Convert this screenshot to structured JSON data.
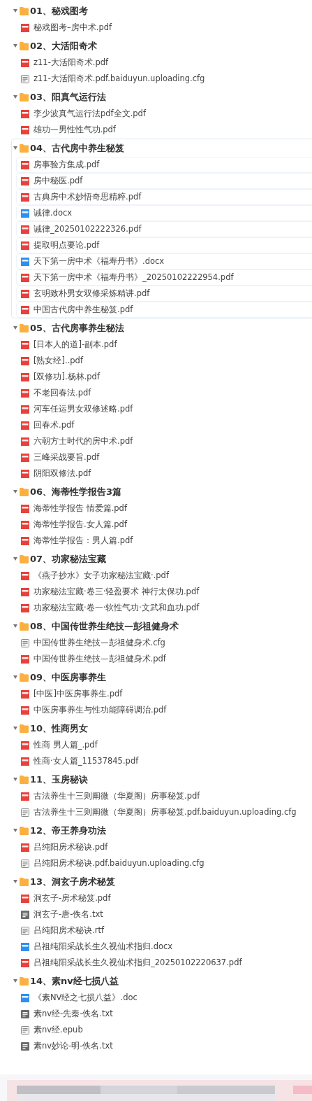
{
  "folders": [
    {
      "name": "01、秘戏图考",
      "expanded": true,
      "selected": false,
      "files": [
        {
          "kind": "pdf",
          "name": "秘戏图考–房中术.pdf"
        }
      ]
    },
    {
      "name": "02、大活阳奇术",
      "expanded": true,
      "selected": false,
      "files": [
        {
          "kind": "pdf",
          "name": "z11-大活阳奇术.pdf"
        },
        {
          "kind": "file",
          "name": "z11-大活阳奇术.pdf.baiduyun.uploading.cfg"
        }
      ]
    },
    {
      "name": "03、阳真气运行法",
      "expanded": true,
      "selected": false,
      "files": [
        {
          "kind": "pdf",
          "name": "李少波真气运行法pdf全文.pdf"
        },
        {
          "kind": "pdf",
          "name": "雄功—男性性气功.pdf"
        }
      ]
    },
    {
      "name": "04、古代房中养生秘笈",
      "expanded": true,
      "selected": true,
      "files": [
        {
          "kind": "pdf",
          "name": "房事验方集成.pdf"
        },
        {
          "kind": "pdf",
          "name": "房中秘医.pdf"
        },
        {
          "kind": "pdf",
          "name": "古典房中术妙悟奇思精粹.pdf"
        },
        {
          "kind": "doc",
          "name": "诫律.docx"
        },
        {
          "kind": "pdf",
          "name": "诫律_20250102222326.pdf"
        },
        {
          "kind": "pdf",
          "name": "提取明点要论.pdf"
        },
        {
          "kind": "doc",
          "name": "天下第一房中术《福寿丹书》.docx"
        },
        {
          "kind": "pdf",
          "name": "天下第一房中术《福寿丹书》_20250102222954.pdf"
        },
        {
          "kind": "pdf",
          "name": "玄明致朴男女双修采炼精讲.pdf"
        },
        {
          "kind": "pdf",
          "name": "中国古代房中养生秘笈.pdf"
        }
      ]
    },
    {
      "name": "05、古代房事养生秘法",
      "expanded": true,
      "selected": false,
      "files": [
        {
          "kind": "pdf",
          "name": "[日本人的道]-副本.pdf"
        },
        {
          "kind": "pdf",
          "name": "[熟女经]..pdf"
        },
        {
          "kind": "pdf",
          "name": "[双修功].杨林.pdf"
        },
        {
          "kind": "pdf",
          "name": "不老回春法.pdf"
        },
        {
          "kind": "pdf",
          "name": "河车任运男女双修述略.pdf"
        },
        {
          "kind": "pdf",
          "name": "回春术.pdf"
        },
        {
          "kind": "pdf",
          "name": "六朝方士时代的房中术.pdf"
        },
        {
          "kind": "pdf",
          "name": "三峰采战要旨.pdf"
        },
        {
          "kind": "pdf",
          "name": "阴阳双修法.pdf"
        }
      ]
    },
    {
      "name": "06、海蒂性学报告3篇",
      "expanded": true,
      "selected": false,
      "files": [
        {
          "kind": "pdf",
          "name": "海蒂性学报告 情爱篇.pdf"
        },
        {
          "kind": "pdf",
          "name": "海蒂性学报告.女人篇.pdf"
        },
        {
          "kind": "pdf",
          "name": "海蒂性学报告：男人篇.pdf"
        }
      ]
    },
    {
      "name": "07、功家秘法宝藏",
      "expanded": true,
      "selected": false,
      "files": [
        {
          "kind": "pdf",
          "name": "《燕子抄水》女子功家秘法宝藏·.pdf"
        },
        {
          "kind": "pdf",
          "name": "功家秘法宝藏·卷三·轻盈要术 神行太保功.pdf"
        },
        {
          "kind": "pdf",
          "name": "功家秘法宝藏·卷一·软性气功·文武和血功.pdf"
        }
      ]
    },
    {
      "name": "08、中国传世养生绝技—彭祖健身术",
      "expanded": true,
      "selected": false,
      "files": [
        {
          "kind": "file",
          "name": "中国传世养生绝技—彭祖健身术.cfg"
        },
        {
          "kind": "pdf",
          "name": "中国传世养生绝技—彭祖健身术.pdf"
        }
      ]
    },
    {
      "name": "09、中医房事养生",
      "expanded": true,
      "selected": false,
      "files": [
        {
          "kind": "pdf",
          "name": "[中医]中医房事养生.pdf"
        },
        {
          "kind": "pdf",
          "name": "中医房事养生与性功能障碍调治.pdf"
        }
      ]
    },
    {
      "name": "10、性商男女",
      "expanded": true,
      "selected": false,
      "files": [
        {
          "kind": "pdf",
          "name": "性商 男人篇_.pdf"
        },
        {
          "kind": "pdf",
          "name": "性商·女人篇_11537845.pdf"
        }
      ]
    },
    {
      "name": "11、玉房秘诀",
      "expanded": true,
      "selected": false,
      "files": [
        {
          "kind": "pdf",
          "name": "古法养生十三则阐微（华夏阁）房事秘笈.pdf"
        },
        {
          "kind": "file",
          "name": "古法养生十三则阐微（华夏阁）房事秘笈.pdf.baiduyun.uploading.cfg"
        }
      ]
    },
    {
      "name": "12、帝王养身功法",
      "expanded": true,
      "selected": false,
      "files": [
        {
          "kind": "pdf",
          "name": "吕纯阳房术秘诀.pdf"
        },
        {
          "kind": "file",
          "name": "吕纯阳房术秘诀.pdf.baiduyun.uploading.cfg"
        }
      ]
    },
    {
      "name": "13、洞玄子房术秘笈",
      "expanded": true,
      "selected": false,
      "files": [
        {
          "kind": "pdf",
          "name": "洞玄子-房术秘笈.pdf"
        },
        {
          "kind": "txt",
          "name": "洞玄子-唐-佚名.txt"
        },
        {
          "kind": "file",
          "name": "吕纯阳房术秘诀.rtf"
        },
        {
          "kind": "doc",
          "name": "吕祖纯阳采战长生久视仙术指归.docx"
        },
        {
          "kind": "pdf",
          "name": "吕祖纯阳采战长生久视仙术指归_20250102220637.pdf"
        }
      ]
    },
    {
      "name": "14、素nv经七损八益",
      "expanded": true,
      "selected": false,
      "files": [
        {
          "kind": "doc",
          "name": "《素NV经之七损八益》.doc"
        },
        {
          "kind": "txt",
          "name": "素nv经-先秦-佚名.txt"
        },
        {
          "kind": "file",
          "name": "素nv经.epub"
        },
        {
          "kind": "txt",
          "name": "素nv妙论-明-佚名.txt"
        }
      ]
    }
  ]
}
